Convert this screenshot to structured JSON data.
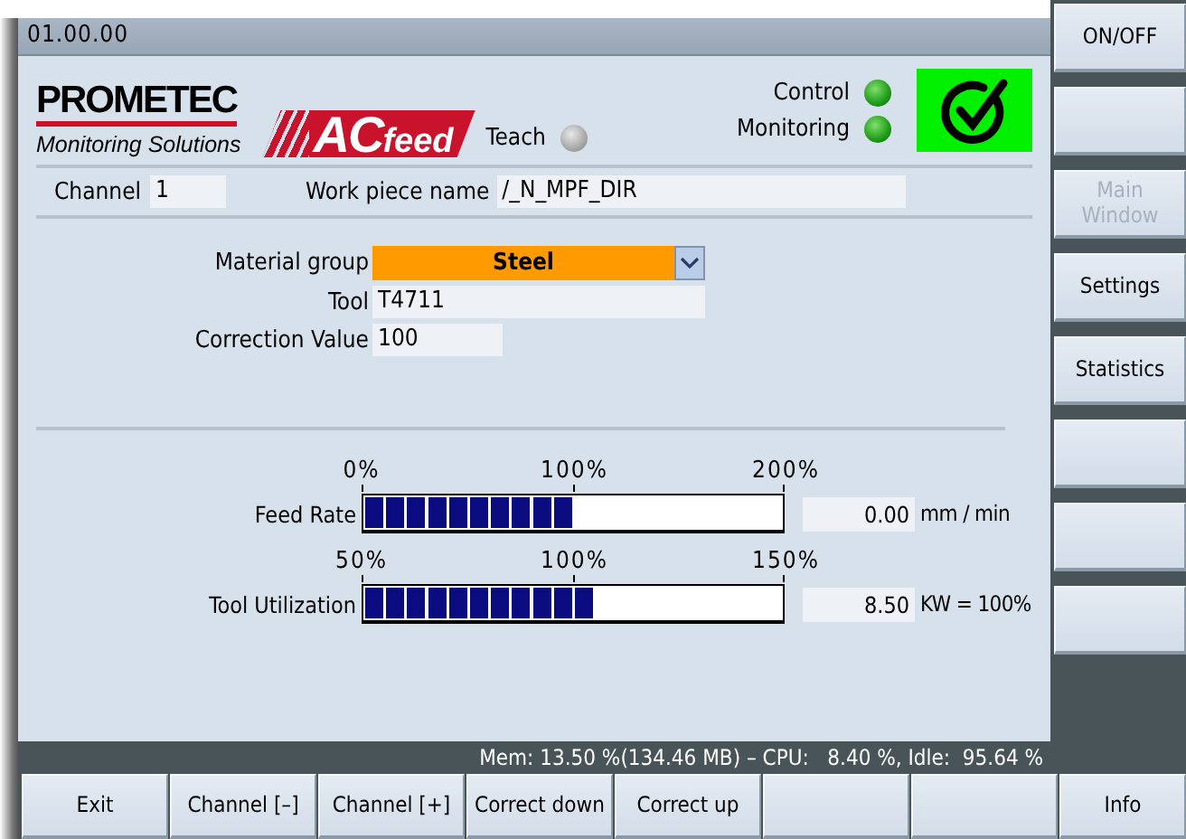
{
  "title_bar": {
    "version": "01.00.00"
  },
  "header": {
    "logo": {
      "company": "PROMETEC",
      "tagline": "Monitoring Solutions",
      "product_prefix": "AC",
      "product_suffix": "feed"
    },
    "lamps": [
      {
        "label": "Teach",
        "on": false
      },
      {
        "label": "Control",
        "on": true
      },
      {
        "label": "Monitoring",
        "on": true
      }
    ],
    "status_ok": true
  },
  "channel": {
    "label": "Channel",
    "value": "1"
  },
  "work_piece": {
    "label": "Work piece name",
    "value": "/_N_MPF_DIR"
  },
  "form": [
    {
      "kind": "dropdown",
      "label": "Material group",
      "value": "Steel"
    },
    {
      "kind": "text",
      "label": "Tool",
      "value": "T4711"
    },
    {
      "kind": "text",
      "label": "Correction Value",
      "value": "100"
    }
  ],
  "meters": [
    {
      "label": "Feed Rate",
      "ticks": [
        "0%",
        "100%",
        "200%"
      ],
      "level": 0.5,
      "reading": "0.00",
      "unit": "mm / min"
    },
    {
      "label": "Tool Utilization",
      "ticks": [
        "50%",
        "100%",
        "150%"
      ],
      "level": 0.55,
      "reading": "8.50",
      "unit": "KW = 100%"
    }
  ],
  "status_bar": "Mem: 13.50 %(134.46 MB) – CPU:   8.40 %, Idle:  95.64 %",
  "side_softkeys": [
    {
      "kind": "labeled",
      "label": "ON/OFF",
      "disabled": false
    },
    {
      "kind": "blank"
    },
    {
      "kind": "labeled",
      "label": "Main Window",
      "disabled": true
    },
    {
      "kind": "labeled",
      "label": "Settings",
      "disabled": false
    },
    {
      "kind": "labeled",
      "label": "Statistics",
      "disabled": false
    },
    {
      "kind": "blank"
    },
    {
      "kind": "blank"
    },
    {
      "kind": "blank"
    }
  ],
  "bottom_softkeys": [
    {
      "kind": "labeled",
      "label": "Exit"
    },
    {
      "kind": "labeled",
      "label": "Channel [–]"
    },
    {
      "kind": "labeled",
      "label": "Channel [+]"
    },
    {
      "kind": "labeled",
      "label": "Correct down"
    },
    {
      "kind": "labeled",
      "label": "Correct up"
    },
    {
      "kind": "blank"
    },
    {
      "kind": "blank"
    },
    {
      "kind": "labeled",
      "label": "Info"
    }
  ]
}
